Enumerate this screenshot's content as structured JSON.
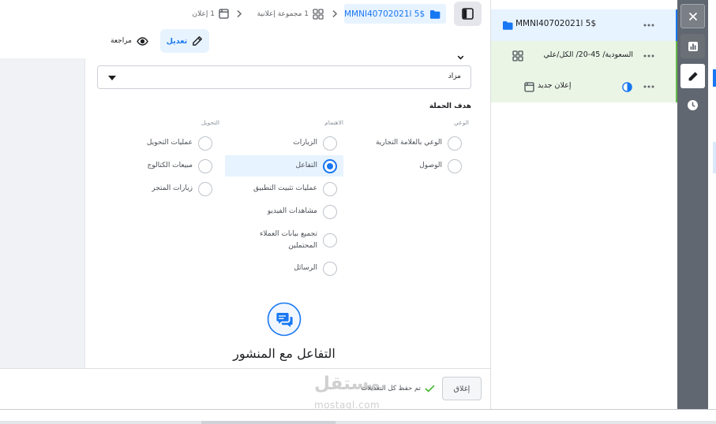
{
  "breadcrumb": {
    "campaign": "MMNI40702021l 5$",
    "adset": "1 مجموعة إعلانية",
    "ad": "1 إعلان"
  },
  "modes": {
    "edit": {
      "label": "تعديل",
      "active": true
    },
    "review": {
      "label": "مراجعة",
      "active": false
    }
  },
  "bid_strategy": {
    "value": "مزاد"
  },
  "objective": {
    "heading": "هدف الحملة",
    "columns": [
      {
        "header": "الوعي",
        "options": [
          {
            "label": "الوعي بالعلامة التجارية",
            "selected": false
          },
          {
            "label": "الوصول",
            "selected": false
          }
        ]
      },
      {
        "header": "الاهتمام",
        "options": [
          {
            "label": "الزيارات",
            "selected": false
          },
          {
            "label": "التفاعل",
            "selected": true
          },
          {
            "label": "عمليات تثبيت التطبيق",
            "selected": false
          },
          {
            "label": "مشاهدات الفيديو",
            "selected": false
          },
          {
            "label": "تجميع بيانات العملاء المحتملين",
            "selected": false
          },
          {
            "label": "الرسائل",
            "selected": false
          }
        ]
      },
      {
        "header": "التحويل",
        "options": [
          {
            "label": "عمليات التحويل",
            "selected": false
          },
          {
            "label": "مبيعات الكتالوج",
            "selected": false
          },
          {
            "label": "زيارات المتجر",
            "selected": false
          }
        ]
      }
    ],
    "detail_title": "التفاعل مع المنشور",
    "detail_icon": "chat-bubbles-icon"
  },
  "footer": {
    "close_label": "إغلاق",
    "save_status": "تم حفظ كل التعديلات"
  },
  "tree": {
    "items": [
      {
        "icon": "folder-icon",
        "label": "MMNI40702021l 5$",
        "selected": true
      },
      {
        "icon": "grid-icon",
        "label": "السعودية/ 45-20/ الكل/علي"
      },
      {
        "icon": "ad-icon",
        "label": "إعلان جديد",
        "status_icon": "half-circle-icon"
      }
    ]
  },
  "side_rail": {
    "buttons": [
      {
        "icon": "close-icon"
      },
      {
        "icon": "bar-chart-icon"
      },
      {
        "icon": "pencil-icon",
        "active": true
      },
      {
        "icon": "clock-icon"
      }
    ]
  },
  "watermark": {
    "brand": "مستقل",
    "url": "mostaql.com"
  },
  "colors": {
    "accent": "#1877f2",
    "selected_bg": "#e7f3ff",
    "adset_bg": "#ebf5e6",
    "saved_green": "#42b72a",
    "rail_bg": "#606770"
  }
}
